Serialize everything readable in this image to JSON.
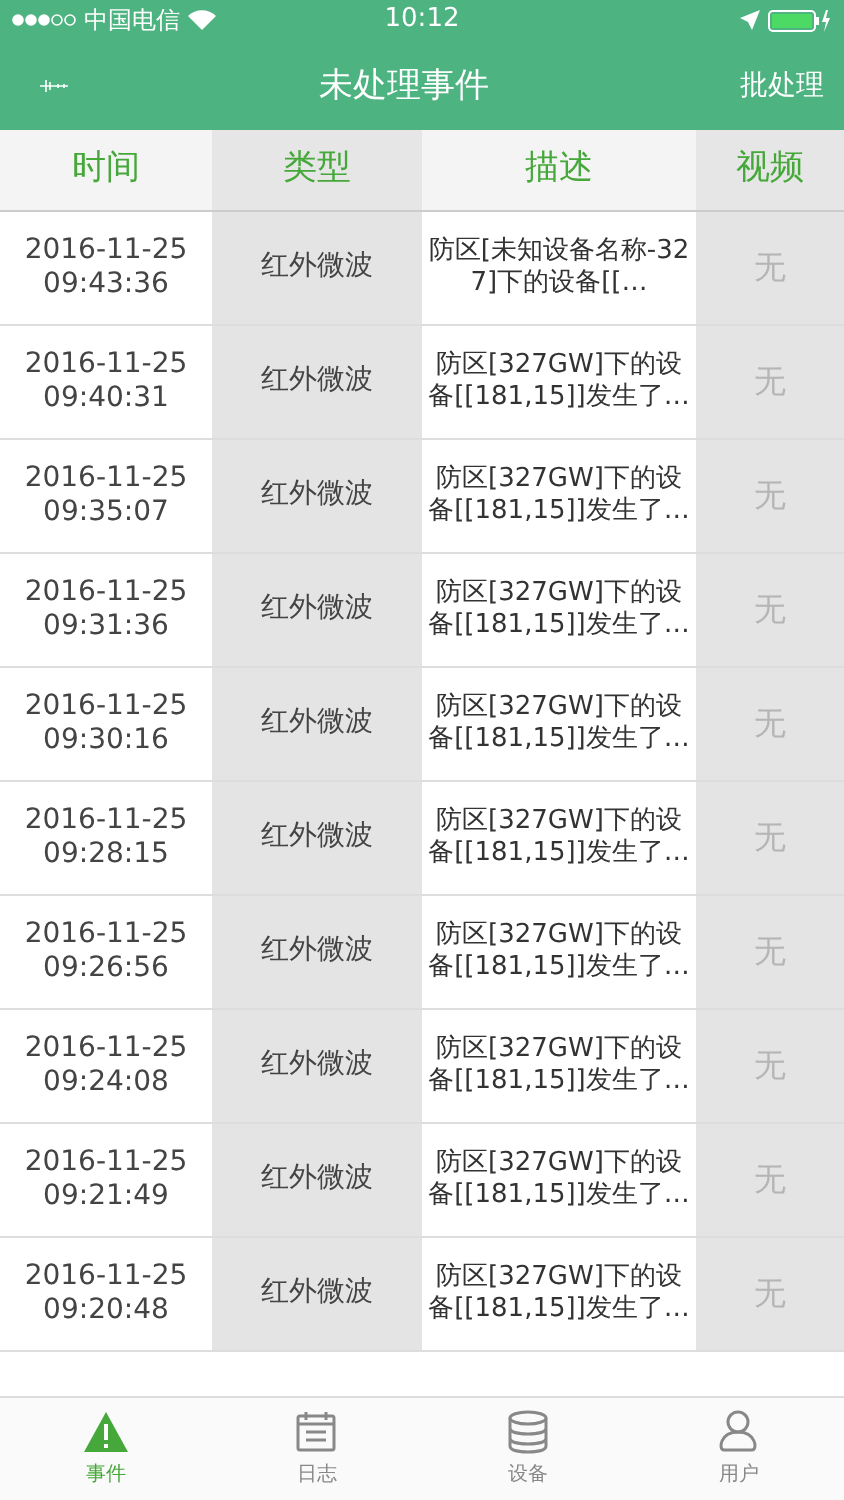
{
  "status_bar": {
    "carrier": "中国电信",
    "time": "10:12"
  },
  "nav": {
    "title": "未处理事件",
    "action": "批处理"
  },
  "table": {
    "columns": [
      "时间",
      "类型",
      "描述",
      "视频"
    ],
    "rows": [
      {
        "date": "2016-11-25",
        "time": "09:43:36",
        "type": "红外微波",
        "description": "防区[未知设备名称-327]下的设备[[…",
        "video": "无"
      },
      {
        "date": "2016-11-25",
        "time": "09:40:31",
        "type": "红外微波",
        "description": "防区[327GW]下的设备[[181,15]]发生了…",
        "video": "无"
      },
      {
        "date": "2016-11-25",
        "time": "09:35:07",
        "type": "红外微波",
        "description": "防区[327GW]下的设备[[181,15]]发生了…",
        "video": "无"
      },
      {
        "date": "2016-11-25",
        "time": "09:31:36",
        "type": "红外微波",
        "description": "防区[327GW]下的设备[[181,15]]发生了…",
        "video": "无"
      },
      {
        "date": "2016-11-25",
        "time": "09:30:16",
        "type": "红外微波",
        "description": "防区[327GW]下的设备[[181,15]]发生了…",
        "video": "无"
      },
      {
        "date": "2016-11-25",
        "time": "09:28:15",
        "type": "红外微波",
        "description": "防区[327GW]下的设备[[181,15]]发生了…",
        "video": "无"
      },
      {
        "date": "2016-11-25",
        "time": "09:26:56",
        "type": "红外微波",
        "description": "防区[327GW]下的设备[[181,15]]发生了…",
        "video": "无"
      },
      {
        "date": "2016-11-25",
        "time": "09:24:08",
        "type": "红外微波",
        "description": "防区[327GW]下的设备[[181,15]]发生了…",
        "video": "无"
      },
      {
        "date": "2016-11-25",
        "time": "09:21:49",
        "type": "红外微波",
        "description": "防区[327GW]下的设备[[181,15]]发生了…",
        "video": "无"
      },
      {
        "date": "2016-11-25",
        "time": "09:20:48",
        "type": "红外微波",
        "description": "防区[327GW]下的设备[[181,15]]发生了…",
        "video": "无"
      }
    ]
  },
  "tab_bar": [
    {
      "kind": "events",
      "label": "事件",
      "selected": true
    },
    {
      "kind": "log",
      "label": "日志",
      "selected": false
    },
    {
      "kind": "devices",
      "label": "设备",
      "selected": false
    },
    {
      "kind": "user",
      "label": "用户",
      "selected": false
    }
  ]
}
